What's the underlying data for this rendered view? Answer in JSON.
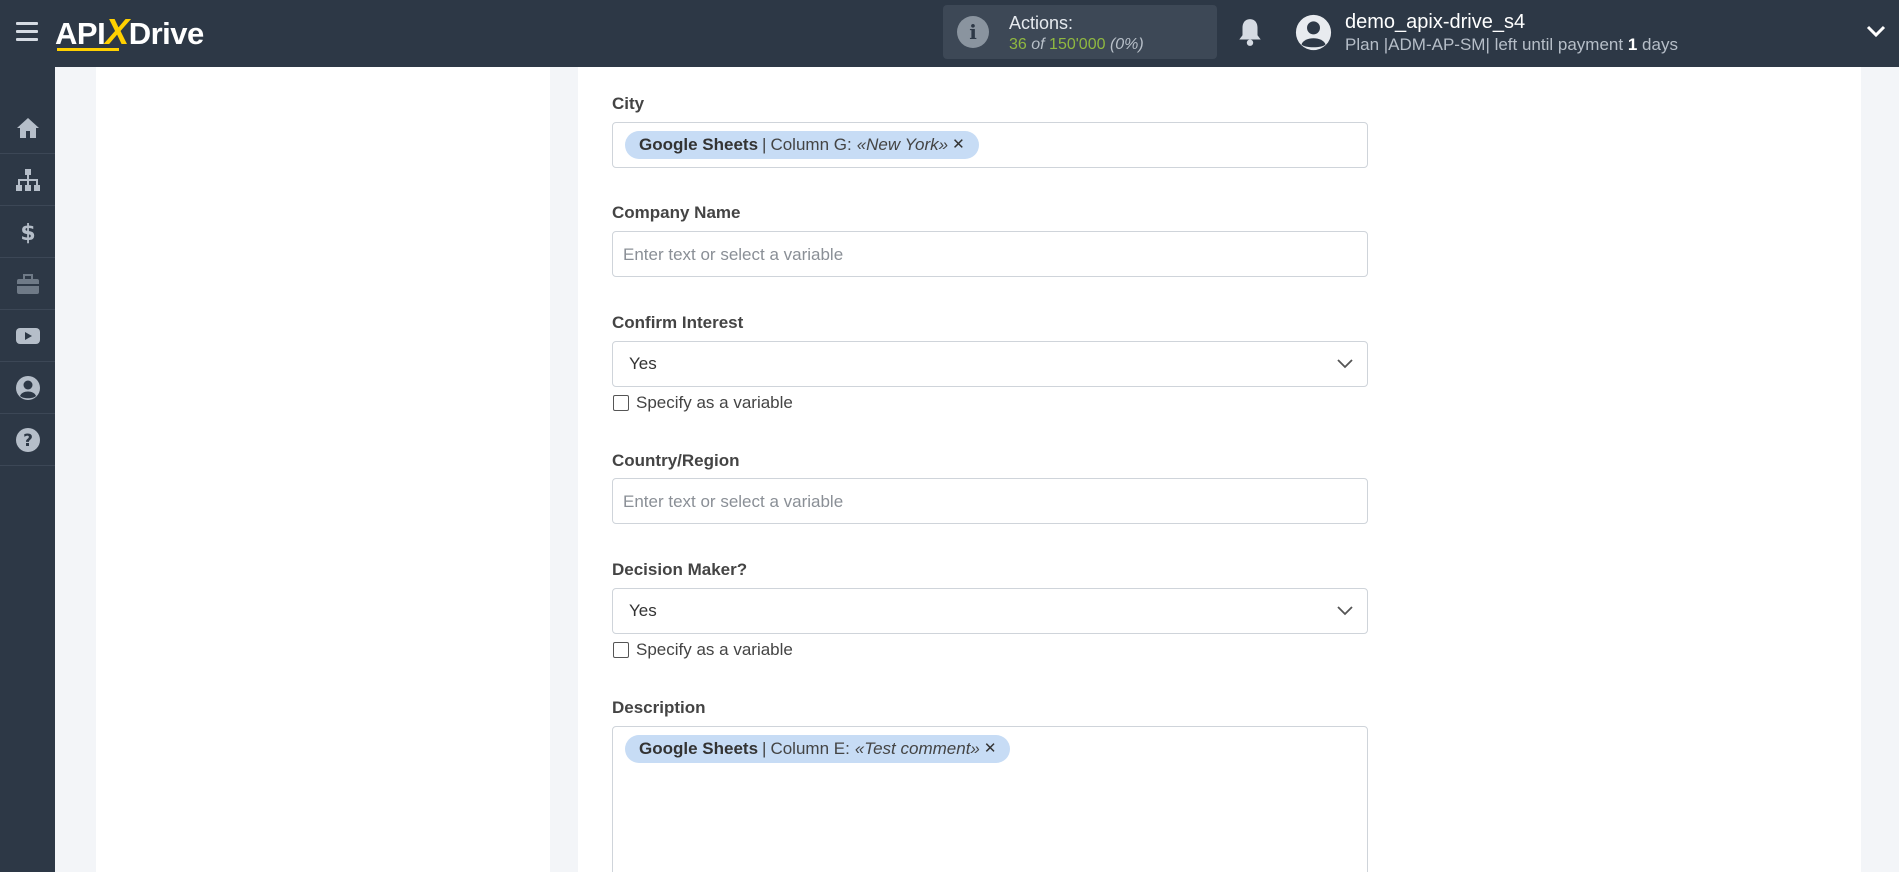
{
  "app": {
    "logo_prefix": "API",
    "logo_x": "X",
    "logo_suffix": "Drive"
  },
  "header": {
    "actions_title": "Actions:",
    "actions_used": "36",
    "actions_of": "of",
    "actions_total": "150'000",
    "actions_pct": "(0%)",
    "user_name": "demo_apix-drive_s4",
    "plan_text": "Plan |ADM-AP-SM| left until payment",
    "plan_days_num": "1",
    "plan_days_word": "days"
  },
  "sidebar": {
    "items": [
      {
        "icon": "home-icon"
      },
      {
        "icon": "sitemap-icon"
      },
      {
        "icon": "dollar-icon"
      },
      {
        "icon": "briefcase-icon"
      },
      {
        "icon": "youtube-icon"
      },
      {
        "icon": "user-circle-icon"
      },
      {
        "icon": "help-icon"
      }
    ]
  },
  "form": {
    "city": {
      "label": "City",
      "chip_source": "Google Sheets",
      "chip_sep": "|",
      "chip_column": "Column G:",
      "chip_value": "«New York»"
    },
    "company_name": {
      "label": "Company Name",
      "placeholder": "Enter text or select a variable"
    },
    "confirm_interest": {
      "label": "Confirm Interest",
      "value": "Yes",
      "checkbox_label": "Specify as a variable"
    },
    "country_region": {
      "label": "Country/Region",
      "placeholder": "Enter text or select a variable"
    },
    "decision_maker": {
      "label": "Decision Maker?",
      "value": "Yes",
      "checkbox_label": "Specify as a variable"
    },
    "description": {
      "label": "Description",
      "chip_source": "Google Sheets",
      "chip_sep": "|",
      "chip_column": "Column E:",
      "chip_value": "«Test comment»"
    }
  },
  "colors": {
    "topbar": "#2d3846",
    "chip": "#c7dcf5",
    "accent_green": "#8fb840",
    "logo_yellow": "#ffd000"
  }
}
